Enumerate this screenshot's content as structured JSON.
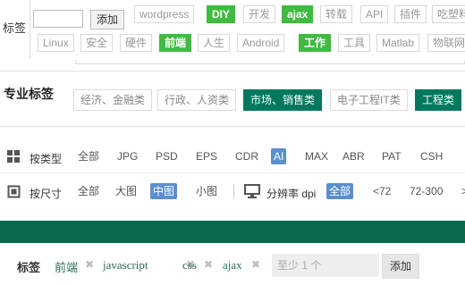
{
  "tag_cloud": {
    "label": "标签",
    "add_label": "添加",
    "row1": [
      {
        "text": "wordpress",
        "active": false
      },
      {
        "text": "DIY",
        "active": true
      },
      {
        "text": "开发",
        "active": false
      },
      {
        "text": "ajax",
        "active": true
      },
      {
        "text": "转载",
        "active": false
      },
      {
        "text": "API",
        "active": false
      },
      {
        "text": "插件",
        "active": false
      },
      {
        "text": "吃塑料",
        "active": false
      }
    ],
    "row2": [
      {
        "text": "Linux",
        "active": false
      },
      {
        "text": "安全",
        "active": false
      },
      {
        "text": "硬件",
        "active": false
      },
      {
        "text": "前端",
        "active": true
      },
      {
        "text": "人生",
        "active": false
      },
      {
        "text": "Android",
        "active": false
      },
      {
        "text": "工作",
        "active": true
      },
      {
        "text": "工具",
        "active": false
      },
      {
        "text": "Matlab",
        "active": false
      },
      {
        "text": "物联网",
        "active": false
      }
    ]
  },
  "categories": {
    "title": "专业标签",
    "items": [
      {
        "text": "经济、金融类",
        "active": false
      },
      {
        "text": "行政、人资类",
        "active": false
      },
      {
        "text": "市场、销售类",
        "active": true
      },
      {
        "text": "电子工程IT类",
        "active": false
      },
      {
        "text": "工程类",
        "active": true
      }
    ]
  },
  "filters": {
    "type": {
      "label": "按类型",
      "icon": "grid-icon",
      "options": [
        {
          "text": "全部",
          "active": false
        },
        {
          "text": "JPG",
          "active": false
        },
        {
          "text": "PSD",
          "active": false
        },
        {
          "text": "EPS",
          "active": false
        },
        {
          "text": "CDR",
          "active": false
        },
        {
          "text": "AI",
          "active": true
        },
        {
          "text": "MAX",
          "active": false
        },
        {
          "text": "ABR",
          "active": false
        },
        {
          "text": "PAT",
          "active": false
        },
        {
          "text": "CSH",
          "active": false
        }
      ]
    },
    "size": {
      "label": "按尺寸",
      "icon": "crop-icon",
      "options": [
        {
          "text": "全部",
          "active": false
        },
        {
          "text": "大图",
          "active": false
        },
        {
          "text": "中图",
          "active": true
        },
        {
          "text": "小图",
          "active": false
        }
      ]
    },
    "resolution": {
      "label": "分辨率 dpi",
      "icon": "monitor-icon",
      "options": [
        {
          "text": "全部",
          "active": true
        },
        {
          "text": "<72",
          "active": false
        },
        {
          "text": "72-300",
          "active": false
        },
        {
          "text": ">",
          "active": false
        }
      ]
    }
  },
  "tag_editor": {
    "label": "标签",
    "tags": [
      "前端",
      "javascript",
      "css",
      "ajax"
    ],
    "remove_glyph": "✖",
    "input_placeholder": "至少 1 个",
    "add_label": "添加"
  },
  "colors": {
    "tag_active": "#3fbb3f",
    "category_active": "#00785e",
    "filter_active": "#5b8fd0",
    "band": "#0a6a50",
    "tag_link": "#2a6f50"
  }
}
